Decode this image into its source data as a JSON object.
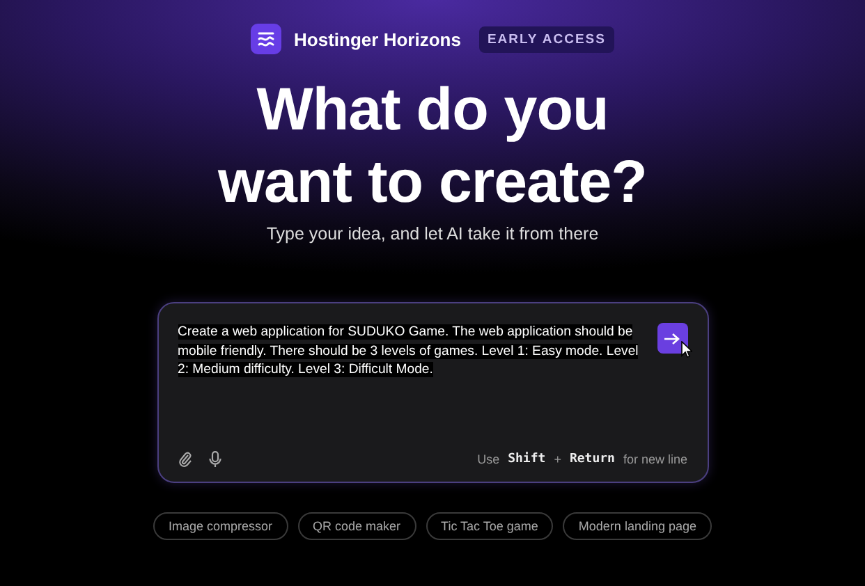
{
  "brand": {
    "name": "Hostinger Horizons",
    "badge": "EARLY ACCESS"
  },
  "hero": {
    "title_lines": [
      "What do you",
      "want to create?"
    ],
    "subtitle": "Type your idea, and let AI take it from there"
  },
  "prompt": {
    "value": "Create a web application for SUDUKO Game. The web application should be mobile friendly. There should be 3 levels of games. Level 1: Easy mode. Level 2: Medium difficulty. Level 3: Difficult Mode.",
    "selected": true,
    "hint": {
      "prefix": "Use",
      "keys": [
        "Shift",
        "Return"
      ],
      "joiner": "+",
      "suffix": "for new line"
    }
  },
  "suggestions": [
    "Image compressor",
    "QR code maker",
    "Tic Tac Toe game",
    "Modern landing page"
  ]
}
